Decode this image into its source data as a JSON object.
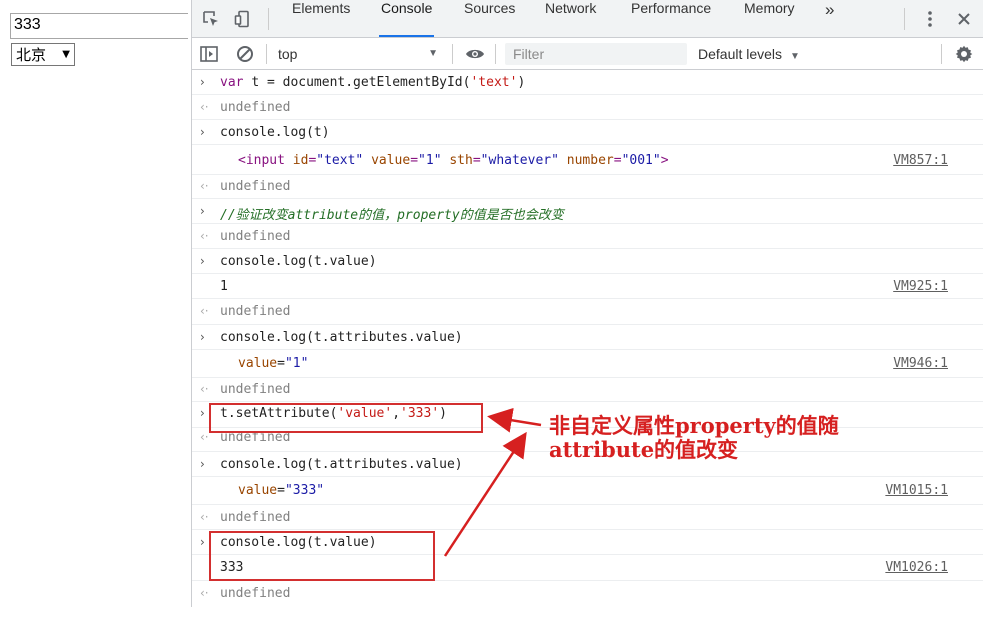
{
  "page": {
    "input_value": "333",
    "select_value": "北京"
  },
  "devtools": {
    "tabs": [
      "Elements",
      "Console",
      "Sources",
      "Network",
      "Performance",
      "Memory"
    ],
    "more_tabs": "»",
    "context": "top",
    "filter_placeholder": "Filter",
    "levels": "Default levels"
  },
  "console": {
    "lines": [
      {
        "input": "var t = document.getElementById('text')"
      },
      {
        "output": "undefined"
      },
      {
        "input": "console.log(t)"
      },
      {
        "log": "<input id=\"text\" value=\"1\" sth=\"whatever\" number=\"001\">",
        "source": "VM857:1"
      },
      {
        "output": "undefined"
      },
      {
        "input": "//验证改变attribute的值，property的值是否也会改变"
      },
      {
        "output": "undefined"
      },
      {
        "input": "console.log(t.value)"
      },
      {
        "log": "1",
        "source": "VM925:1"
      },
      {
        "output": "undefined"
      },
      {
        "input": "console.log(t.attributes.value)"
      },
      {
        "log": "value=\"1\"",
        "source": "VM946:1"
      },
      {
        "output": "undefined"
      },
      {
        "input": "t.setAttribute('value','333')"
      },
      {
        "output": "undefined"
      },
      {
        "input": "console.log(t.attributes.value)"
      },
      {
        "log": "value=\"333\"",
        "source": "VM1015:1"
      },
      {
        "output": "undefined"
      },
      {
        "input": "console.log(t.value)"
      },
      {
        "log": "333",
        "source": "VM1026:1"
      },
      {
        "output": "undefined"
      }
    ]
  },
  "annotation": {
    "line1": "非自定义属性property的值随",
    "line2": "attribute的值改变",
    "color": "#d62020"
  }
}
